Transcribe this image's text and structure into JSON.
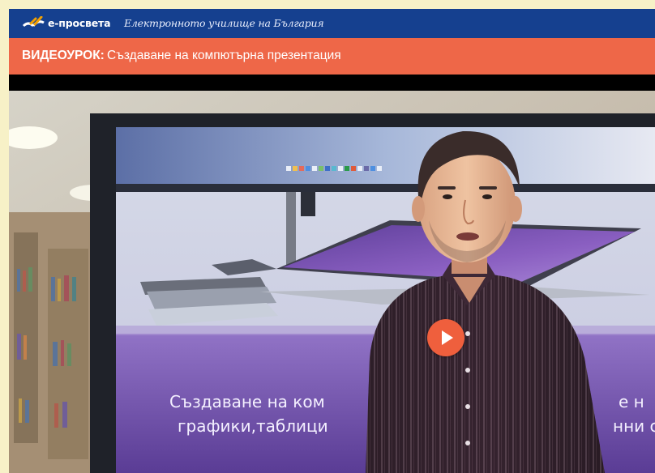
{
  "header": {
    "brand": "e-просвета",
    "tagline": "Електронното училище на България",
    "logo_icon": "book-icon"
  },
  "video": {
    "title_prefix": "ВИДЕОУРОК:",
    "title": "Създаване на компютърна презентация",
    "slide_line1_left": "Създаване на ком",
    "slide_line1_right": "е н",
    "slide_line2_left": "графики,таблици",
    "slide_line2_right": "нни с",
    "play_icon": "play-icon"
  },
  "colors": {
    "header": "#15408f",
    "title_bar": "#ee6748",
    "page_background": "#f7f1c7",
    "play_button": "#ef5f3d"
  }
}
